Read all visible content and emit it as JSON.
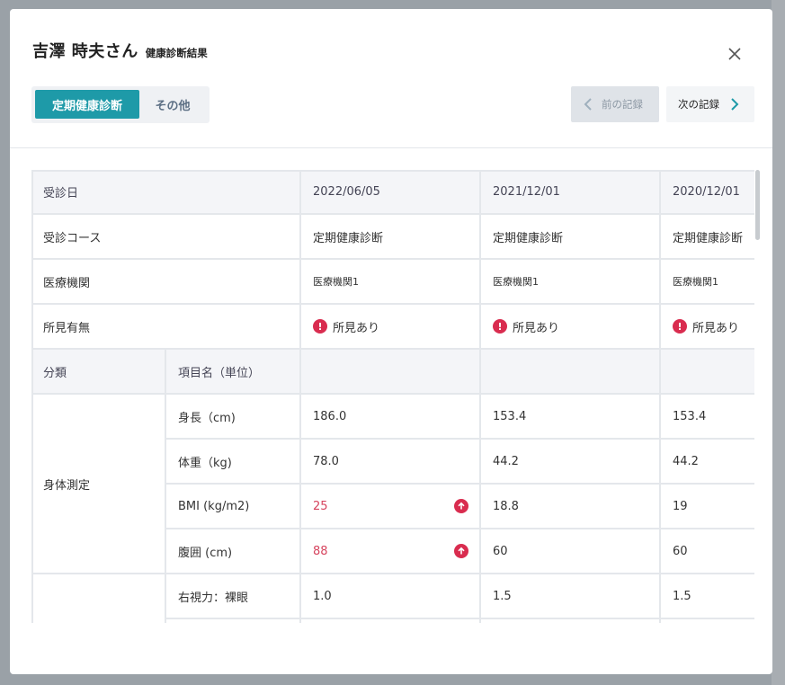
{
  "modal": {
    "title_name": "吉澤 時夫さん",
    "title_sub": "健康診断結果",
    "close_icon": "close-icon"
  },
  "tabs": [
    {
      "label": "定期健康診断",
      "active": true
    },
    {
      "label": "その他",
      "active": false
    }
  ],
  "nav": {
    "prev_label": "前の記録",
    "next_label": "次の記録"
  },
  "table": {
    "row_labels": {
      "exam_date": "受診日",
      "course": "受診コース",
      "institution": "医療機関",
      "findings": "所見有無",
      "category": "分類",
      "item_name": "項目名（単位）"
    },
    "records": [
      {
        "date": "2022/06/05",
        "course": "定期健康診断",
        "institution": "医療機関1",
        "findings": "所見あり"
      },
      {
        "date": "2021/12/01",
        "course": "定期健康診断",
        "institution": "医療機関1",
        "findings": "所見あり"
      },
      {
        "date": "2020/12/01",
        "course": "定期健康診断",
        "institution": "医療機関1",
        "findings": "所見あり"
      }
    ],
    "categories": [
      {
        "name": "身体測定",
        "items": [
          {
            "name": "身長（cm)",
            "values": [
              "186.0",
              "153.4",
              "153.4"
            ],
            "high": [
              false,
              false,
              false
            ]
          },
          {
            "name": "体重（kg)",
            "values": [
              "78.0",
              "44.2",
              "44.2"
            ],
            "high": [
              false,
              false,
              false
            ]
          },
          {
            "name": "BMI (kg/m2)",
            "values": [
              "25",
              "18.8",
              "19"
            ],
            "high": [
              true,
              false,
              false
            ]
          },
          {
            "name": "腹囲 (cm)",
            "values": [
              "88",
              "60",
              "60"
            ],
            "high": [
              true,
              false,
              false
            ]
          }
        ]
      },
      {
        "name": "",
        "items": [
          {
            "name": "右視力：裸眼",
            "values": [
              "1.0",
              "1.5",
              "1.5"
            ],
            "high": [
              false,
              false,
              false
            ]
          }
        ]
      }
    ]
  },
  "colors": {
    "accent": "#1e9aa8",
    "alert": "#d92c4f",
    "high_value": "#d6445e"
  }
}
